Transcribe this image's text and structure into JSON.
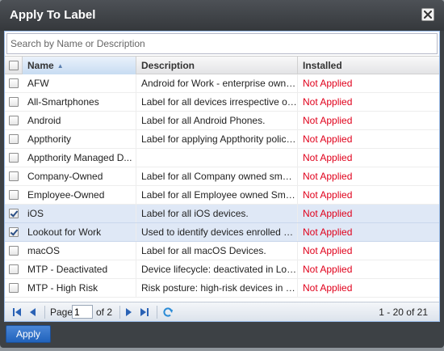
{
  "dialog": {
    "title": "Apply To Label"
  },
  "search": {
    "placeholder": "Search by Name or Description"
  },
  "grid": {
    "columns": {
      "name": "Name",
      "description": "Description",
      "installed": "Installed"
    },
    "rows": [
      {
        "name": "AFW",
        "description": "Android for Work - enterprise owned...",
        "installed": "Not Applied",
        "checked": false
      },
      {
        "name": "All-Smartphones",
        "description": "Label for all devices irrespective of OS",
        "installed": "Not Applied",
        "checked": false
      },
      {
        "name": "Android",
        "description": "Label for all Android Phones.",
        "installed": "Not Applied",
        "checked": false
      },
      {
        "name": "Appthority",
        "description": "Label for applying Appthority policie...",
        "installed": "Not Applied",
        "checked": false
      },
      {
        "name": "Appthority Managed D...",
        "description": "",
        "installed": "Not Applied",
        "checked": false
      },
      {
        "name": "Company-Owned",
        "description": "Label for all Company owned smart...",
        "installed": "Not Applied",
        "checked": false
      },
      {
        "name": "Employee-Owned",
        "description": "Label for all Employee owned Smart...",
        "installed": "Not Applied",
        "checked": false
      },
      {
        "name": "iOS",
        "description": "Label for all iOS devices.",
        "installed": "Not Applied",
        "checked": true
      },
      {
        "name": "Lookout for Work",
        "description": "Used to identify devices enrolled wit...",
        "installed": "Not Applied",
        "checked": true
      },
      {
        "name": "macOS",
        "description": "Label for all macOS Devices.",
        "installed": "Not Applied",
        "checked": false
      },
      {
        "name": "MTP - Deactivated",
        "description": "Device lifecycle: deactivated in Look...",
        "installed": "Not Applied",
        "checked": false
      },
      {
        "name": "MTP - High Risk",
        "description": "Risk posture: high-risk devices in Lo...",
        "installed": "Not Applied",
        "checked": false
      }
    ]
  },
  "pager": {
    "page_label": "Page",
    "current_page": "1",
    "of_label": "of 2",
    "info": "1 - 20 of 21"
  },
  "footer": {
    "apply_label": "Apply"
  }
}
